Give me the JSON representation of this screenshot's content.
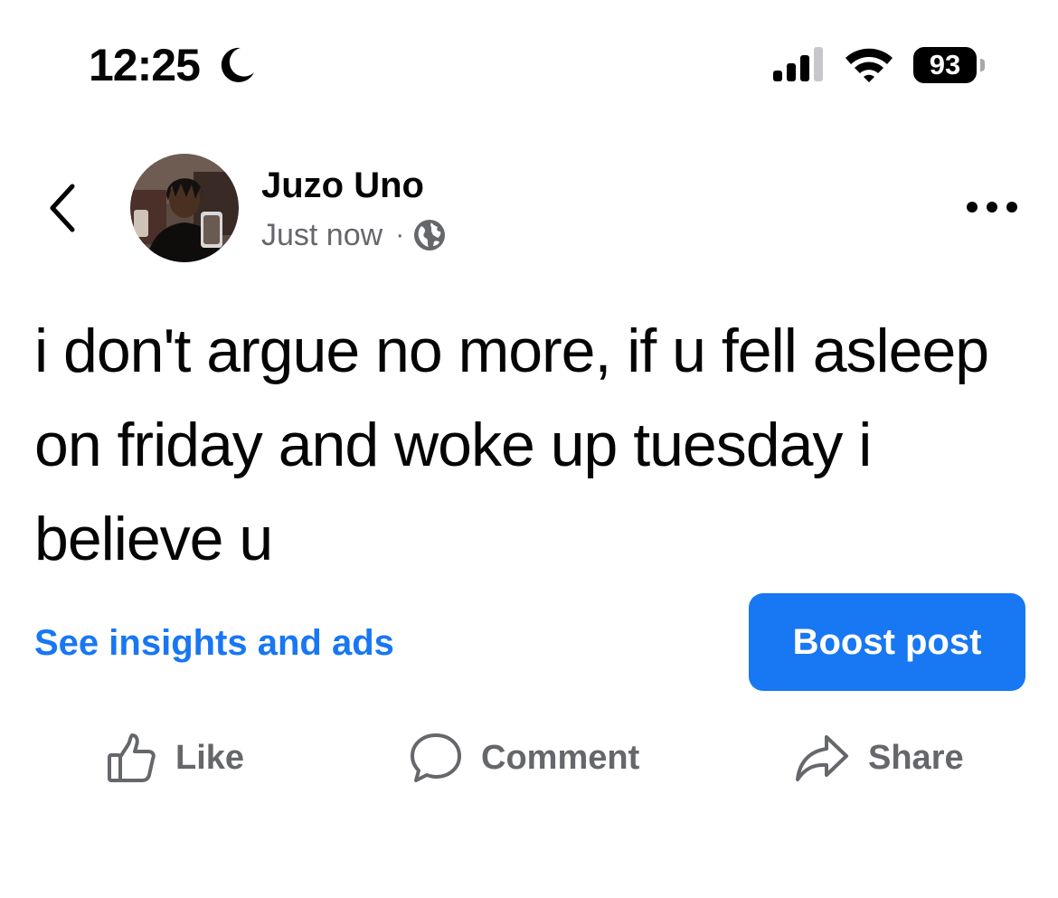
{
  "status_bar": {
    "time": "12:25",
    "battery_level": "93",
    "icons": [
      "moon-icon",
      "signal-icon",
      "wifi-icon",
      "battery-icon"
    ]
  },
  "post": {
    "author": "Juzo Uno",
    "timestamp": "Just now",
    "separator": "·",
    "privacy_icon": "globe-icon",
    "text": "i don't argue no more, if u fell asleep on friday and woke up tuesday i believe u"
  },
  "promo": {
    "insights_label": "See insights and ads",
    "boost_label": "Boost post"
  },
  "actions": {
    "like_label": "Like",
    "comment_label": "Comment",
    "share_label": "Share"
  },
  "colors": {
    "accent": "#1877f2",
    "secondary_text": "#65676b",
    "primary_text": "#050505"
  }
}
